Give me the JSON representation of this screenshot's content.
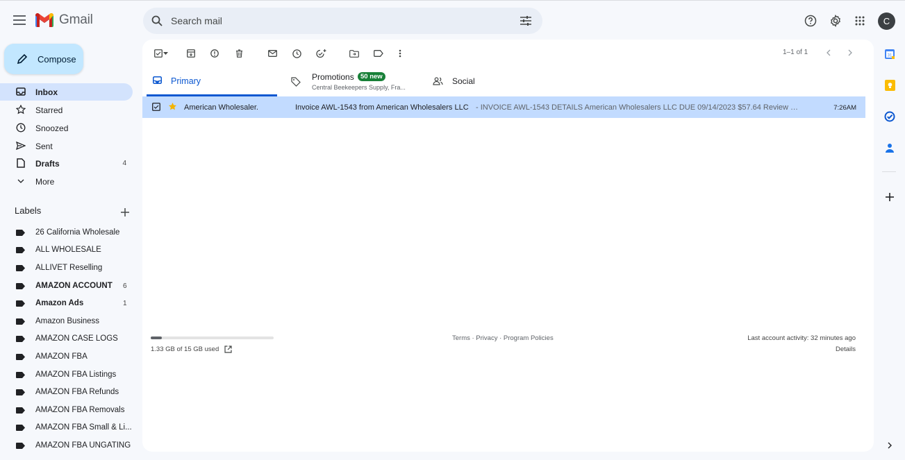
{
  "app": {
    "logo_text": "Gmail",
    "avatar_letter": "C"
  },
  "search": {
    "placeholder": "Search mail"
  },
  "compose": {
    "label": "Compose"
  },
  "nav": {
    "items": [
      {
        "label": "Inbox",
        "count": "",
        "icon": "inbox-icon"
      },
      {
        "label": "Starred",
        "count": "",
        "icon": "star-icon"
      },
      {
        "label": "Snoozed",
        "count": "",
        "icon": "clock-icon"
      },
      {
        "label": "Sent",
        "count": "",
        "icon": "send-icon"
      },
      {
        "label": "Drafts",
        "count": "4",
        "icon": "draft-icon"
      },
      {
        "label": "More",
        "count": "",
        "icon": "chevron-down-icon"
      }
    ]
  },
  "labels": {
    "heading": "Labels",
    "items": [
      {
        "label": "26 California Wholesale",
        "count": ""
      },
      {
        "label": "ALL WHOLESALE",
        "count": ""
      },
      {
        "label": "ALLIVET Reselling",
        "count": ""
      },
      {
        "label": "AMAZON ACCOUNT",
        "count": "6"
      },
      {
        "label": "Amazon Ads",
        "count": "1"
      },
      {
        "label": "Amazon Business",
        "count": ""
      },
      {
        "label": "AMAZON CASE LOGS",
        "count": ""
      },
      {
        "label": "AMAZON FBA",
        "count": ""
      },
      {
        "label": "AMAZON FBA Listings",
        "count": ""
      },
      {
        "label": "AMAZON FBA Refunds",
        "count": ""
      },
      {
        "label": "AMAZON FBA Removals",
        "count": ""
      },
      {
        "label": "AMAZON FBA Small & Li...",
        "count": ""
      },
      {
        "label": "AMAZON FBA UNGATING",
        "count": ""
      }
    ]
  },
  "toolbar": {
    "pager": "1–1 of 1"
  },
  "tabs": {
    "primary": "Primary",
    "promotions": {
      "label": "Promotions",
      "badge": "50 new",
      "sub": "Central Beekeepers Supply, Fra..."
    },
    "social": "Social"
  },
  "email": {
    "sender": "American Wholesaler.",
    "subject": "Invoice AWL-1543 from American Wholesalers LLC",
    "snippet": " - INVOICE AWL-1543 DETAILS American Wholesalers LLC DUE 09/14/2023 $57.64 Review an...",
    "time": "7:26AM"
  },
  "footer": {
    "storage": "1.33 GB of 15 GB used",
    "storage_fraction": 0.089,
    "links": "Terms · Privacy · Program Policies",
    "last_activity": "Last account activity: 32 minutes ago",
    "details": "Details"
  },
  "colors": {
    "accent": "#0b57d0",
    "compose_bg": "#c2e7ff",
    "selected_row": "#c2dbff",
    "badge": "#188038"
  }
}
